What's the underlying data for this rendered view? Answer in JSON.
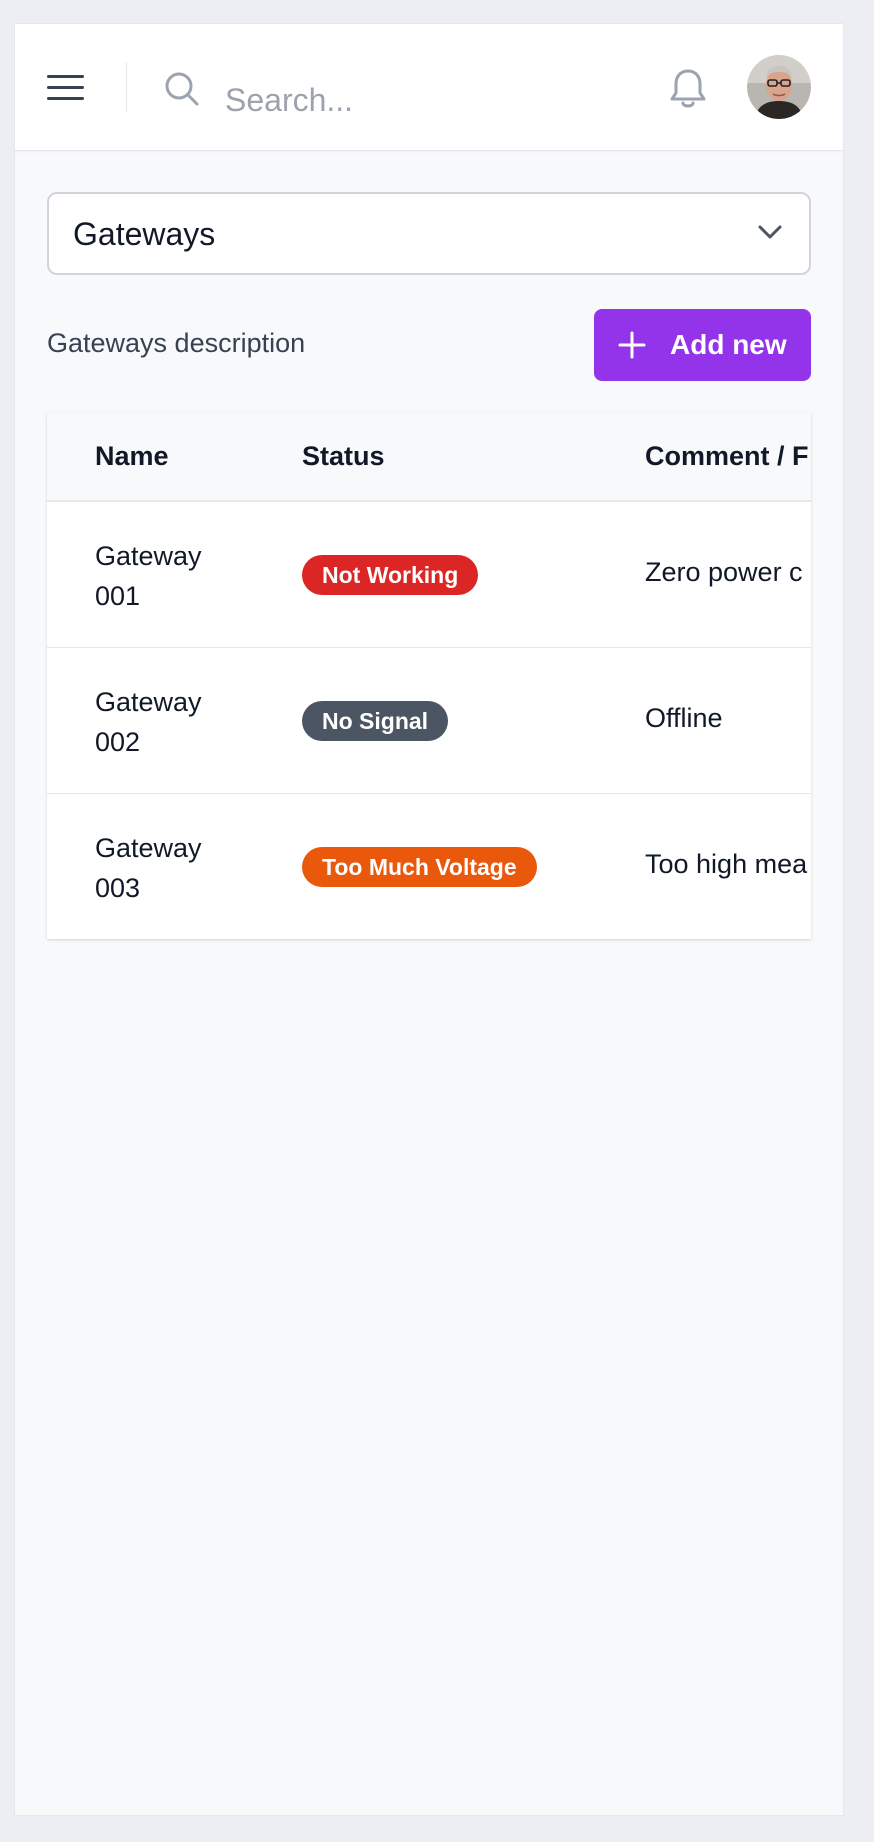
{
  "header": {
    "search_placeholder": "Search..."
  },
  "select": {
    "value": "Gateways"
  },
  "page": {
    "description": "Gateways description",
    "add_button_label": "Add new"
  },
  "table": {
    "columns": [
      "Name",
      "Status",
      "Comment / F"
    ],
    "rows": [
      {
        "name": "Gateway 001",
        "status": "Not Working",
        "comment": "Zero power c"
      },
      {
        "name": "Gateway 002",
        "status": "No Signal",
        "comment": "Offline"
      },
      {
        "name": "Gateway 003",
        "status": "Too Much Voltage",
        "comment": "Too high mea"
      }
    ]
  },
  "colors": {
    "accent": "#9333ea",
    "status_not_working": "#dc2626",
    "status_no_signal": "#4b5563",
    "status_too_much_voltage": "#ea580c"
  },
  "icons": [
    "menu-icon",
    "search-icon",
    "bell-icon",
    "chevron-down-icon",
    "plus-icon"
  ]
}
